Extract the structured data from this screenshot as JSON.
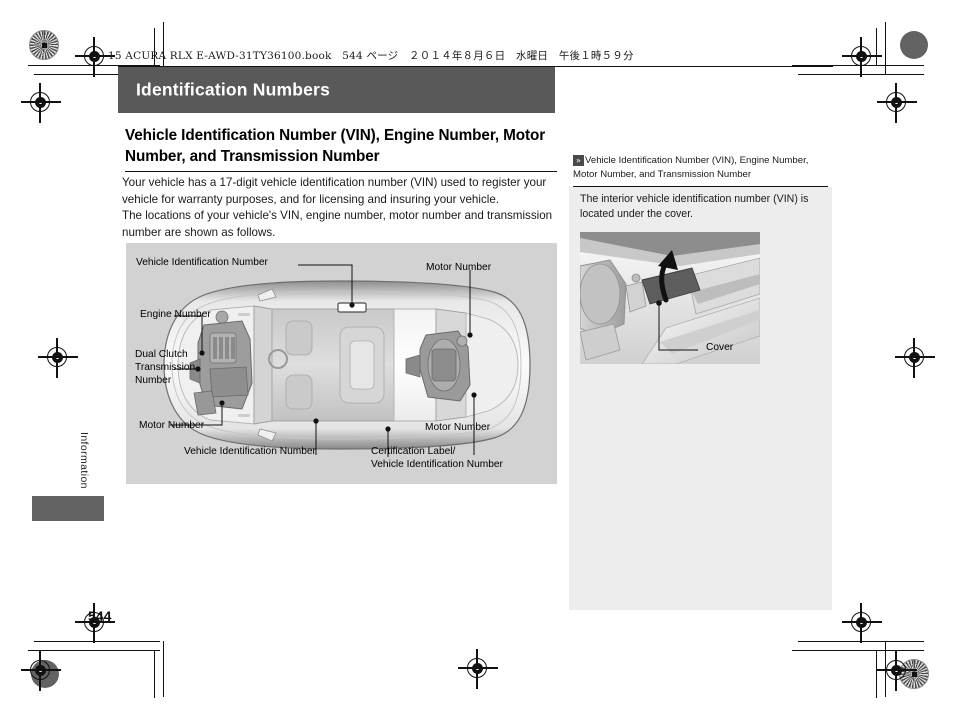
{
  "document": {
    "book_header": "15 ACURA RLX E-AWD-31TY36100.book　544 ページ　２０１４年８月６日　水曜日　午後１時５９分",
    "page_number": "544",
    "section_tab": "Information",
    "banner_title": "Identification Numbers"
  },
  "main": {
    "heading": "Vehicle Identification Number (VIN), Engine Number, Motor Number, and Transmission Number",
    "paragraph1": "Your vehicle has a 17-digit vehicle identification number (VIN) used to register your vehicle for warranty purposes, and for licensing and insuring your vehicle.",
    "paragraph2": "The locations of your vehicle's VIN, engine number, motor number and transmission number are shown as follows."
  },
  "diagram": {
    "labels": {
      "vin_top": "Vehicle Identification Number",
      "motor_top_right": "Motor Number",
      "engine": "Engine Number",
      "dual_clutch": "Dual Clutch\nTransmission\nNumber",
      "motor_bottom_left": "Motor Number",
      "motor_bottom_right": "Motor Number",
      "vin_bottom": "Vehicle Identification Number",
      "certification": "Certification Label/\nVehicle Identification Number"
    }
  },
  "sidebar": {
    "ref_icon": "»",
    "ref_title": "Vehicle Identification Number (VIN), Engine Number, Motor Number, and Transmission Number",
    "body": "The interior vehicle identification number (VIN) is located under the cover.",
    "image_label": "Cover"
  },
  "colors": {
    "banner": "#595959",
    "diagram_bg": "#d2d2d2",
    "sidebar_bg": "#ededed",
    "tab_block": "#636363",
    "text": "#1a1a1a"
  }
}
